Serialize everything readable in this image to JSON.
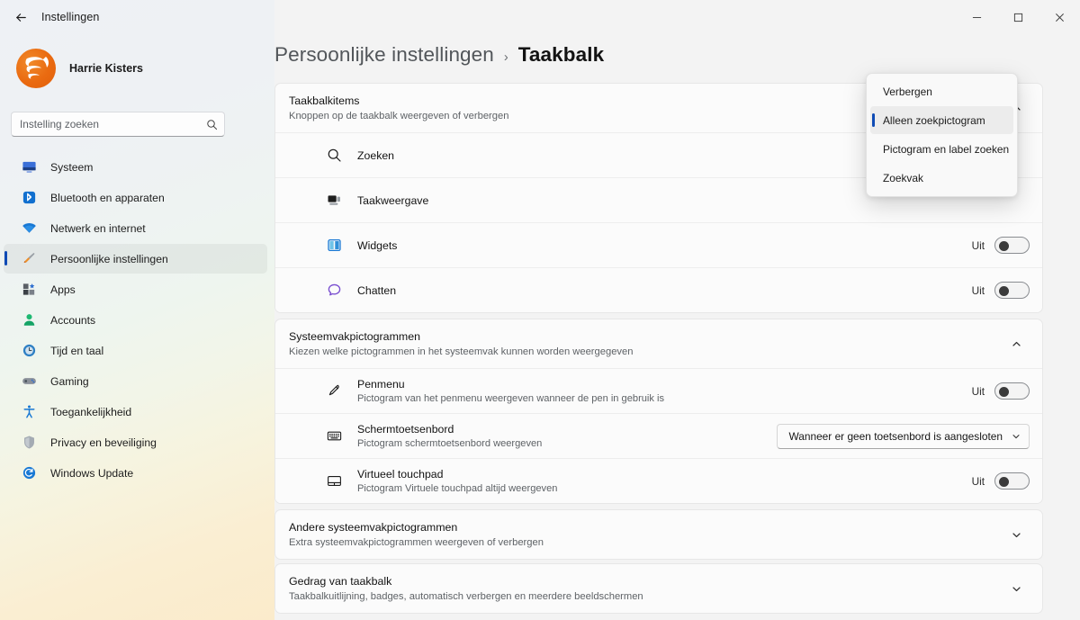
{
  "window": {
    "title": "Instellingen",
    "back_icon": "back-arrow-icon",
    "minimize_label": "—",
    "maximize_label": "□",
    "close_label": "✕"
  },
  "sidebar": {
    "profile": {
      "name": "Harrie Kisters",
      "avatar_icon": "user-avatar"
    },
    "search": {
      "placeholder": "Instelling zoeken",
      "value": "",
      "icon": "search-icon"
    },
    "items": [
      {
        "label": "Systeem",
        "icon": "monitor-icon",
        "selected": false
      },
      {
        "label": "Bluetooth en apparaten",
        "icon": "bluetooth-icon",
        "selected": false
      },
      {
        "label": "Netwerk en internet",
        "icon": "wifi-icon",
        "selected": false
      },
      {
        "label": "Persoonlijke instellingen",
        "icon": "paintbrush-icon",
        "selected": true
      },
      {
        "label": "Apps",
        "icon": "apps-icon",
        "selected": false
      },
      {
        "label": "Accounts",
        "icon": "account-icon",
        "selected": false
      },
      {
        "label": "Tijd en taal",
        "icon": "clock-icon",
        "selected": false
      },
      {
        "label": "Gaming",
        "icon": "gamepad-icon",
        "selected": false
      },
      {
        "label": "Toegankelijkheid",
        "icon": "accessibility-icon",
        "selected": false
      },
      {
        "label": "Privacy en beveiliging",
        "icon": "shield-icon",
        "selected": false
      },
      {
        "label": "Windows Update",
        "icon": "update-icon",
        "selected": false
      }
    ]
  },
  "breadcrumb": {
    "parent": "Persoonlijke instellingen",
    "separator": "›",
    "current": "Taakbalk"
  },
  "cards": {
    "taskbar_items": {
      "title": "Taakbalkitems",
      "subtitle": "Knoppen op de taakbalk weergeven of verbergen",
      "expanded": true,
      "chevron": "chevron-up-icon",
      "rows": [
        {
          "title": "Zoeken",
          "sub": "",
          "icon": "search-icon",
          "control": "none",
          "toggle_label": "",
          "toggle_on": false
        },
        {
          "title": "Taakweergave",
          "sub": "",
          "icon": "task-view-icon",
          "control": "none",
          "toggle_label": "",
          "toggle_on": false
        },
        {
          "title": "Widgets",
          "sub": "",
          "icon": "widgets-icon",
          "control": "toggle",
          "toggle_label": "Uit",
          "toggle_on": false
        },
        {
          "title": "Chatten",
          "sub": "",
          "icon": "chat-icon",
          "control": "toggle",
          "toggle_label": "Uit",
          "toggle_on": false
        }
      ]
    },
    "tray_icons": {
      "title": "Systeemvakpictogrammen",
      "subtitle": "Kiezen welke pictogrammen in het systeemvak kunnen worden weergegeven",
      "expanded": true,
      "chevron": "chevron-up-icon",
      "rows": [
        {
          "title": "Penmenu",
          "sub": "Pictogram van het penmenu weergeven wanneer de pen in gebruik is",
          "icon": "pen-icon",
          "control": "toggle",
          "toggle_label": "Uit",
          "toggle_on": false
        },
        {
          "title": "Schermtoetsenbord",
          "sub": "Pictogram schermtoetsenbord weergeven",
          "icon": "keyboard-icon",
          "control": "select",
          "select_value": "Wanneer er geen toetsenbord is aangesloten",
          "toggle_label": "",
          "toggle_on": false
        },
        {
          "title": "Virtueel touchpad",
          "sub": "Pictogram Virtuele touchpad altijd weergeven",
          "icon": "touchpad-icon",
          "control": "toggle",
          "toggle_label": "Uit",
          "toggle_on": false
        }
      ]
    },
    "other_tray_icons": {
      "title": "Andere systeemvakpictogrammen",
      "subtitle": "Extra systeemvakpictogrammen weergeven of verbergen",
      "expanded": false,
      "chevron": "chevron-down-icon"
    },
    "taskbar_behavior": {
      "title": "Gedrag van taakbalk",
      "subtitle": "Taakbalkuitlijning, badges, automatisch verbergen en meerdere beeldschermen",
      "expanded": false,
      "chevron": "chevron-down-icon"
    }
  },
  "flyout": {
    "open": true,
    "items": [
      {
        "label": "Verbergen",
        "selected": false
      },
      {
        "label": "Alleen zoekpictogram",
        "selected": true
      },
      {
        "label": "Pictogram en label zoeken",
        "selected": false
      },
      {
        "label": "Zoekvak",
        "selected": false
      }
    ]
  },
  "colors": {
    "accent": "#0f4bb5",
    "card_bg": "#fbfbfb",
    "page_bg": "#f3f3f3",
    "avatar_orange": "#ea6a10"
  }
}
